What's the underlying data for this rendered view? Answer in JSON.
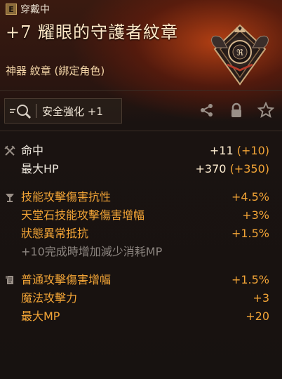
{
  "header": {
    "badge_letter": "E",
    "equipped_label": "穿戴中",
    "item_title": "+7 耀眼的守護者紋章",
    "item_type": "神器 紋章 (綁定角色)"
  },
  "toolbar": {
    "enhance_label": "安全強化 +1",
    "icons": [
      "magnify-icon",
      "share-icon",
      "lock-icon",
      "star-icon"
    ]
  },
  "stat_groups": [
    {
      "icon": "crossed-swords-icon",
      "rows": [
        {
          "label": "命中",
          "value": "+11",
          "bonus": "(+10)"
        },
        {
          "label": "最大HP",
          "value": "+370",
          "bonus": "(+350)"
        }
      ]
    },
    {
      "icon": "chalice-icon",
      "rows": [
        {
          "label": "技能攻擊傷害抗性",
          "value": "+4.5%"
        },
        {
          "label": "天堂石技能攻擊傷害增幅",
          "value": "+3%"
        },
        {
          "label": "狀態異常抵抗",
          "value": "+1.5%"
        }
      ],
      "note": "+10完成時增加減少消耗MP"
    },
    {
      "icon": "scroll-icon",
      "rows": [
        {
          "label": "普通攻擊傷害增幅",
          "value": "+1.5%"
        },
        {
          "label": "魔法攻擊力",
          "value": "+3"
        },
        {
          "label": "最大MP",
          "value": "+20"
        }
      ]
    }
  ],
  "colors": {
    "accent_orange": "#f2a436",
    "title": "#ffe9c8",
    "background": "#171210"
  }
}
